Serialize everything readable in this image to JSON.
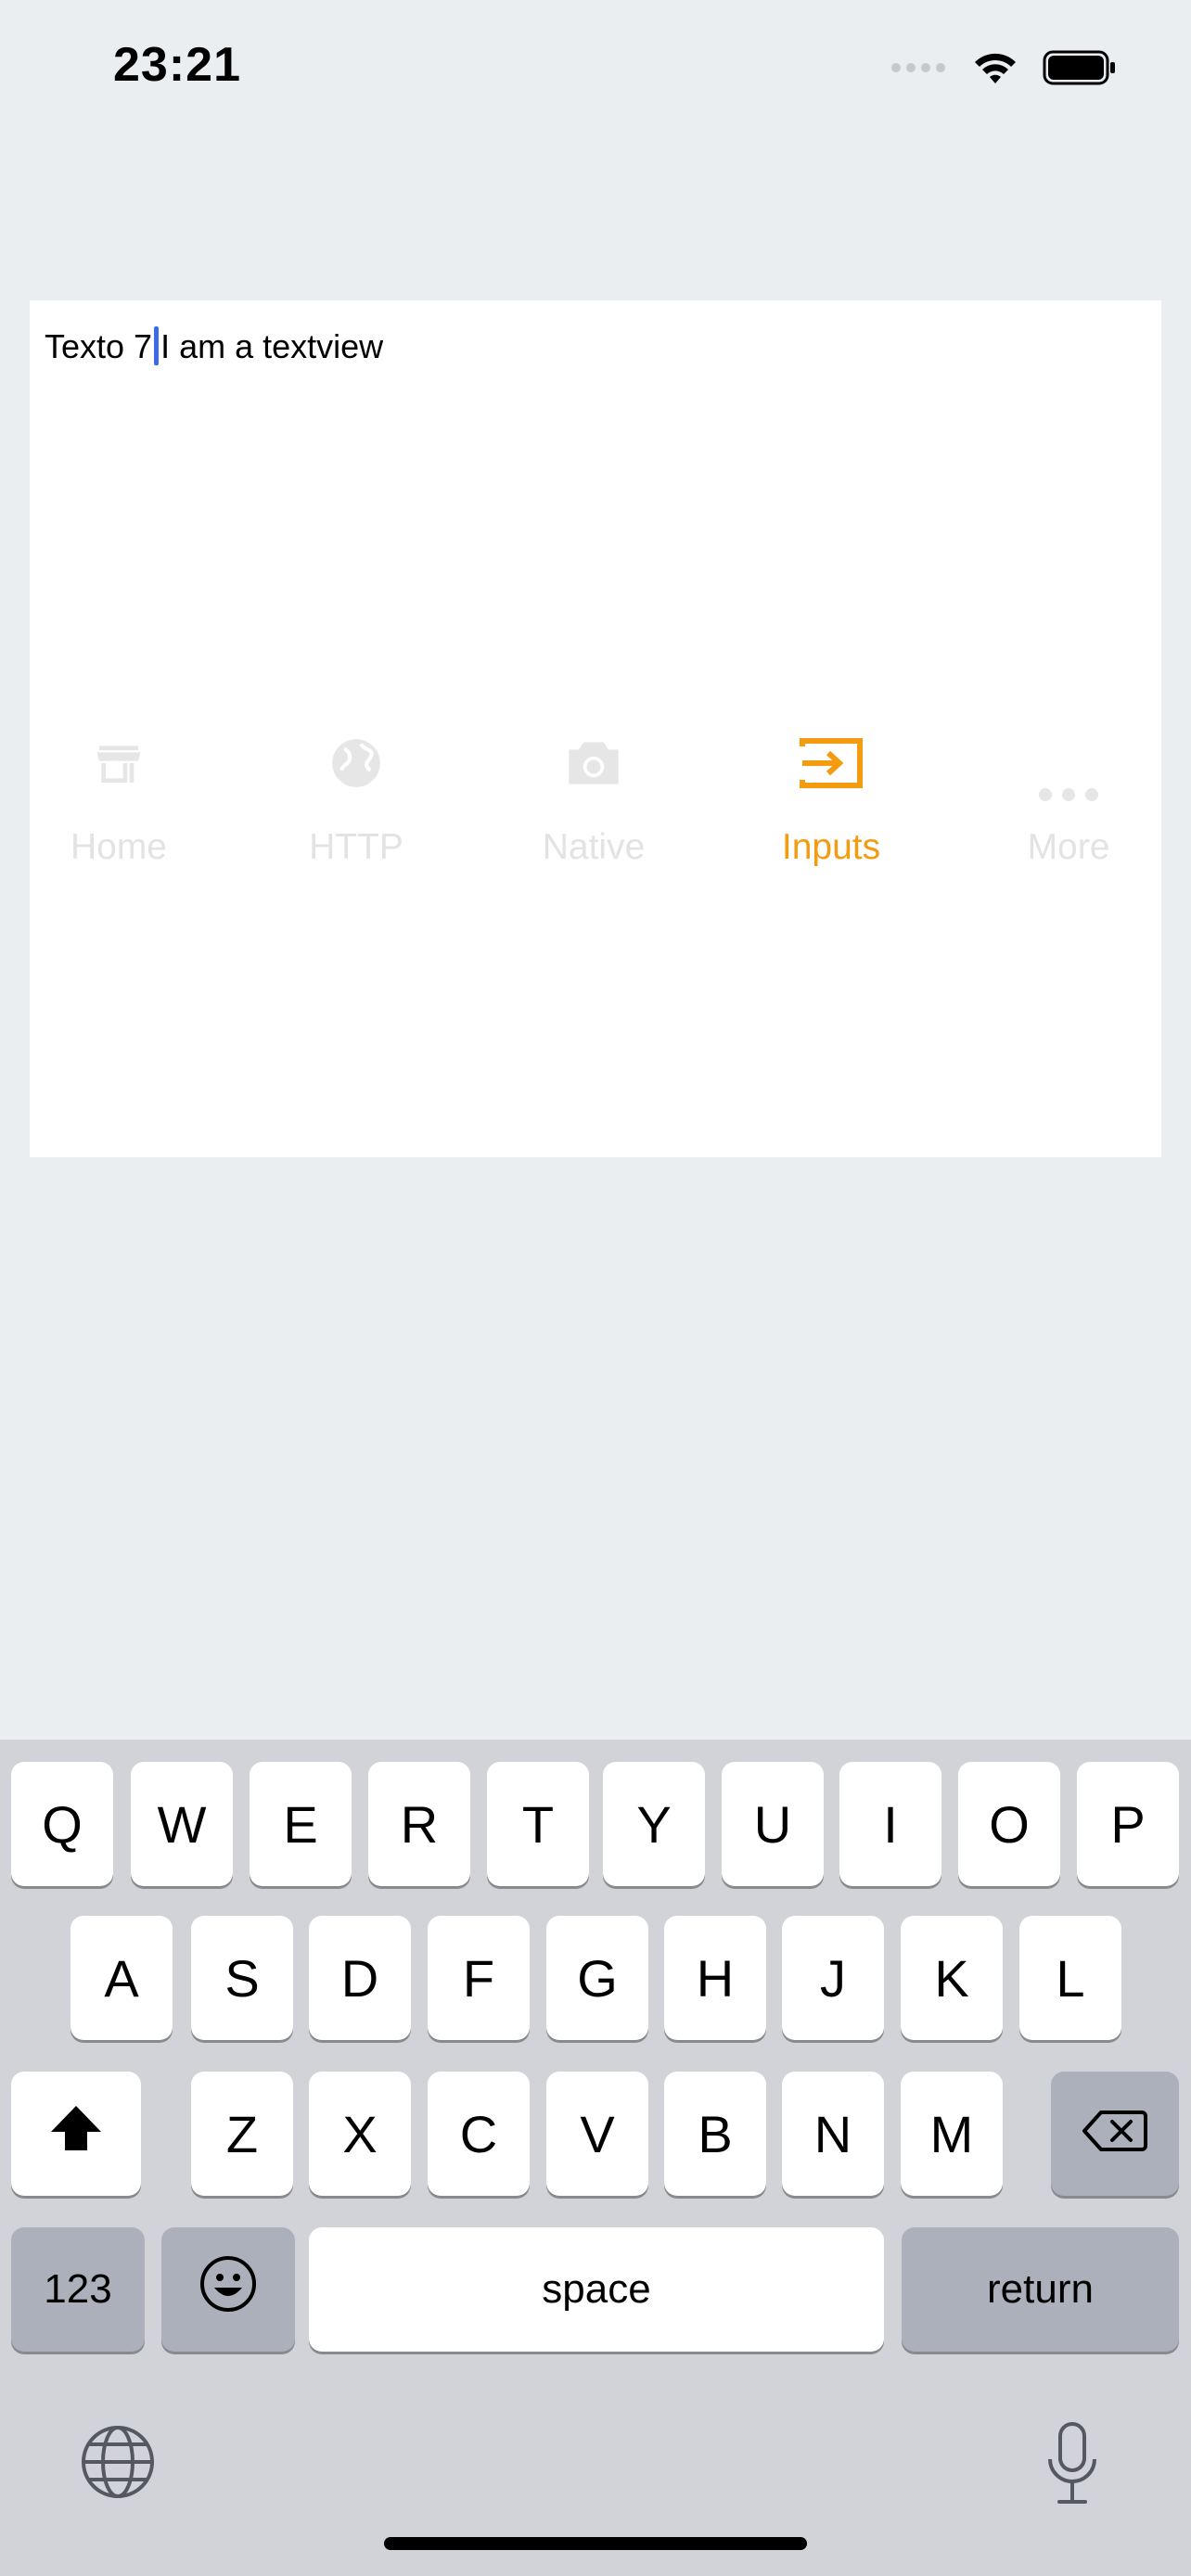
{
  "status_bar": {
    "time": "23:21",
    "icons": [
      "signal-dots-icon",
      "wifi-icon",
      "battery-icon"
    ]
  },
  "textview": {
    "text_before_caret": "Texto 7",
    "text_after_caret": "I am a textview"
  },
  "tabbar": {
    "active_color": "#f39c12",
    "inactive_color": "#e3e3e3",
    "tabs": [
      {
        "label": "Home",
        "icon": "store-icon",
        "active": false
      },
      {
        "label": "HTTP",
        "icon": "globe-icon",
        "active": false
      },
      {
        "label": "Native",
        "icon": "camera-icon",
        "active": false
      },
      {
        "label": "Inputs",
        "icon": "input-icon",
        "active": true
      },
      {
        "label": "More",
        "icon": "more-dots-icon",
        "active": false
      }
    ]
  },
  "keyboard": {
    "row1": [
      "Q",
      "W",
      "E",
      "R",
      "T",
      "Y",
      "U",
      "I",
      "O",
      "P"
    ],
    "row2": [
      "A",
      "S",
      "D",
      "F",
      "G",
      "H",
      "J",
      "K",
      "L"
    ],
    "row3": [
      "Z",
      "X",
      "C",
      "V",
      "B",
      "N",
      "M"
    ],
    "numbers_key": "123",
    "space_key": "space",
    "return_key": "return",
    "icons": [
      "shift-icon",
      "backspace-icon",
      "emoji-icon",
      "globe-icon",
      "microphone-icon"
    ]
  }
}
